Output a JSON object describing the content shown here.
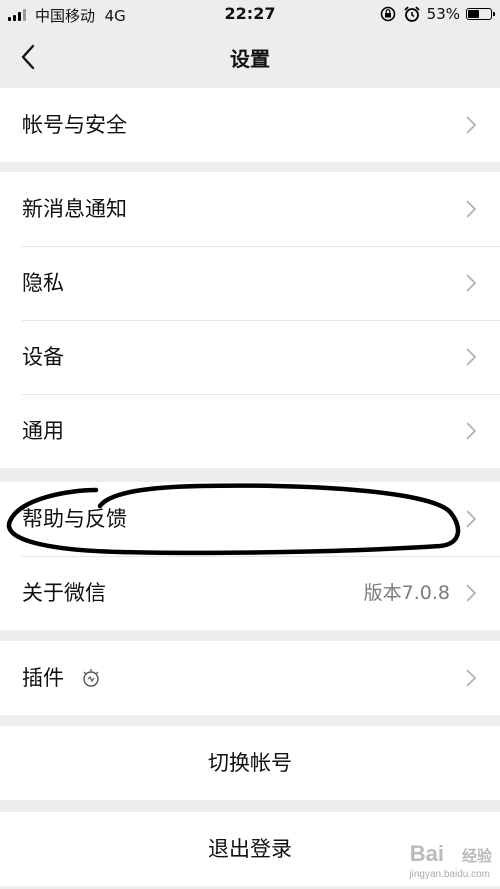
{
  "status_bar": {
    "carrier": "中国移动",
    "network": "4G",
    "time": "22:27",
    "battery_percent": "53%",
    "battery_level": 0.53,
    "icons": [
      "signal-icon",
      "rotation-lock-icon",
      "alarm-icon",
      "battery-icon"
    ]
  },
  "nav": {
    "back_icon": "chevron-left-icon",
    "title": "设置"
  },
  "groups": [
    {
      "items": [
        {
          "label": "帐号与安全"
        }
      ]
    },
    {
      "items": [
        {
          "label": "新消息通知"
        },
        {
          "label": "隐私"
        },
        {
          "label": "设备"
        },
        {
          "label": "通用"
        }
      ]
    },
    {
      "items": [
        {
          "label": "帮助与反馈"
        },
        {
          "label": "关于微信",
          "value": "版本7.0.8"
        }
      ]
    },
    {
      "items": [
        {
          "label": "插件",
          "icon": "bulb-icon"
        }
      ]
    }
  ],
  "actions": {
    "switch_account": "切换帐号",
    "logout": "退出登录"
  },
  "watermark": {
    "brand": "Bai",
    "brand_suffix": "经验",
    "url": "jingyan.baidu.com"
  },
  "annotation": {
    "color": "#000000",
    "target": "帮助与反馈"
  }
}
